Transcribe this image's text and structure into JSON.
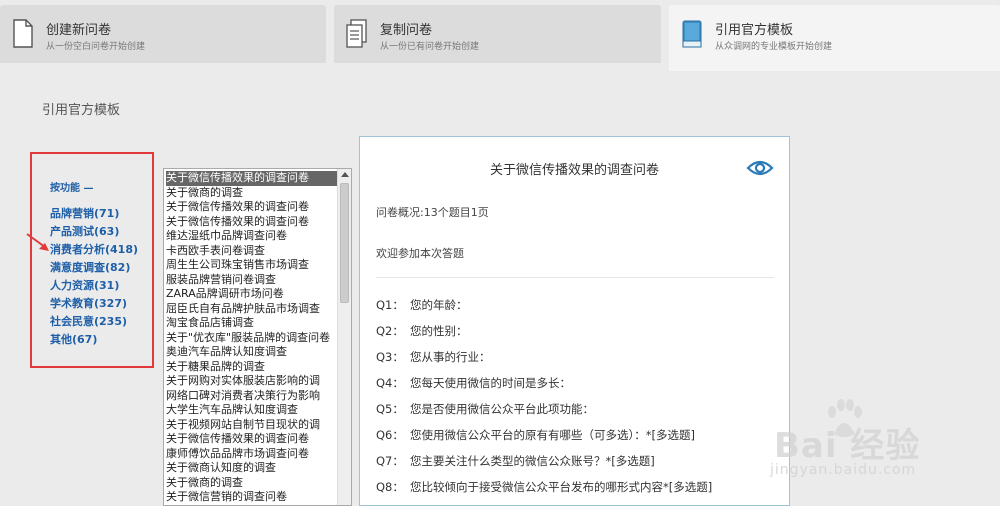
{
  "tabs": [
    {
      "title": "创建新问卷",
      "subtitle": "从一份空白问卷开始创建",
      "icon": "blank-document-icon"
    },
    {
      "title": "复制问卷",
      "subtitle": "从一份已有问卷开始创建",
      "icon": "copy-document-icon"
    },
    {
      "title": "引用官方模板",
      "subtitle": "从众调网的专业模板开始创建",
      "icon": "template-book-icon"
    }
  ],
  "active_tab": 2,
  "section_title": "引用官方模板",
  "categories": {
    "header": "按功能 —",
    "items": [
      "品牌营销(71)",
      "产品测试(63)",
      "消费者分析(418)",
      "满意度调查(82)",
      "人力资源(31)",
      "学术教育(327)",
      "社会民意(235)",
      "其他(67)"
    ]
  },
  "template_list": [
    "关于微信传播效果的调查问卷",
    "关于微商的调查",
    "关于微信传播效果的调查问卷",
    "关于微信传播效果的调查问卷",
    "维达湿纸巾品牌调查问卷",
    "卡西欧手表问卷调查",
    "周生生公司珠宝销售市场调查",
    "服装品牌营销问卷调查",
    "ZARA品牌调研市场问卷",
    "屈臣氏自有品牌护肤品市场调查",
    "淘宝食品店铺调查",
    "关于\"优衣库\"服装品牌的调查问卷",
    "奥迪汽车品牌认知度调查",
    "关于糖果品牌的调查",
    "关于网购对实体服装店影响的调",
    "网络口碑对消费者决策行为影响",
    "大学生汽车品牌认知度调查",
    "关于视频网站自制节目现状的调",
    "关于微信传播效果的调查问卷",
    "康师傅饮品品牌市场调查问卷",
    "关于微商认知度的调查",
    "关于微商的调查",
    "关于微信营销的调查问卷"
  ],
  "selected_index": 0,
  "preview": {
    "title": "关于微信传播效果的调查问卷",
    "summary": "问卷概况:13个题目1页",
    "welcome": "欢迎参加本次答题",
    "questions": [
      {
        "num": "Q1：",
        "text": "您的年龄："
      },
      {
        "num": "Q2：",
        "text": "您的性别："
      },
      {
        "num": "Q3：",
        "text": "您从事的行业："
      },
      {
        "num": "Q4：",
        "text": "您每天使用微信的时间是多长："
      },
      {
        "num": "Q5：",
        "text": "您是否使用微信公众平台此项功能："
      },
      {
        "num": "Q6：",
        "text": "您使用微信公众平台的原有有哪些（可多选）：*[多选题]"
      },
      {
        "num": "Q7：",
        "text": "您主要关注什么类型的微信公众账号？*[多选题]"
      },
      {
        "num": "Q8：",
        "text": "您比较倾向于接受微信公众平台发布的哪形式内容*[多选题]"
      }
    ]
  },
  "watermark": {
    "brand": "Bai 经验",
    "url": "jingyan.baidu.com"
  },
  "colors": {
    "accent": "#1f5fa8",
    "highlight_border": "#e03a3a",
    "selected_bg": "#666666",
    "preview_border": "#9fc3d8"
  }
}
